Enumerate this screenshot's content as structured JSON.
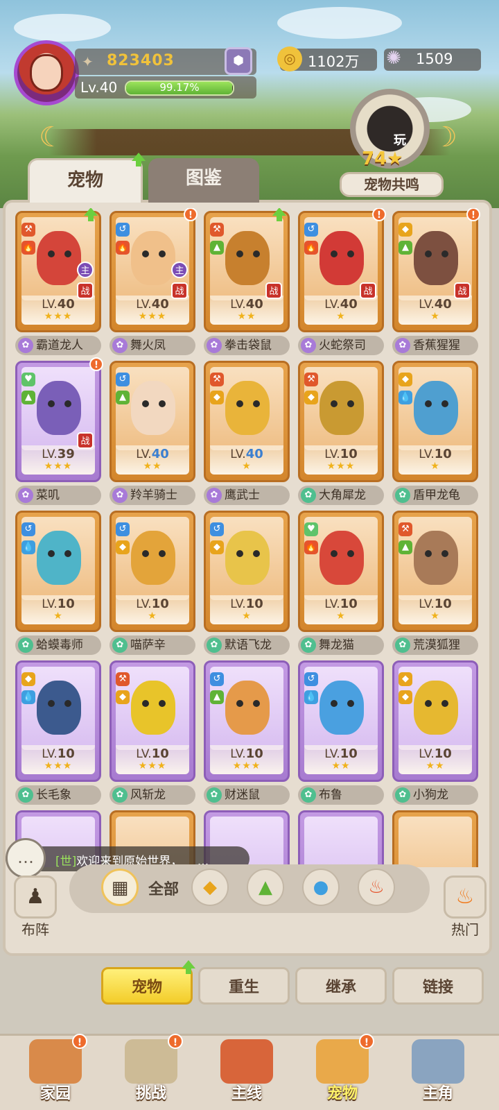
{
  "player": {
    "power": "823403",
    "level": "Lv.40",
    "exp_percent": "99.17%",
    "exp_fraction": 0.9917
  },
  "currency": {
    "gold": "1102万",
    "shells": "1509"
  },
  "resonance": {
    "play_label": "玩",
    "count": "74",
    "label": "宠物共鸣"
  },
  "tabs": [
    {
      "label": "宠物"
    },
    {
      "label": "图鉴"
    }
  ],
  "pets": [
    {
      "name": "霸道龙人",
      "lv": "40",
      "stars": "★★★",
      "card": "orange",
      "paw": "purple",
      "main": "主",
      "battle": "战",
      "elem1": "⚒",
      "elem2": "🔥",
      "c": "#d4453a"
    },
    {
      "name": "舞火凤",
      "lv": "40",
      "stars": "★★★",
      "card": "orange",
      "paw": "purple",
      "main": "主",
      "battle": "战",
      "elem1": "↺",
      "elem2": "🔥",
      "c": "#f0c08a"
    },
    {
      "name": "拳击袋鼠",
      "lv": "40",
      "stars": "★★",
      "card": "orange",
      "paw": "purple",
      "battle": "战",
      "elem1": "⚒",
      "elem2": "▲",
      "c": "#c7802e"
    },
    {
      "name": "火蛇祭司",
      "lv": "40",
      "stars": "★",
      "card": "orange",
      "paw": "purple",
      "battle": "战",
      "elem1": "↺",
      "elem2": "🔥",
      "c": "#d23a36"
    },
    {
      "name": "香蕉猩猩",
      "lv": "40",
      "stars": "★",
      "card": "orange",
      "paw": "purple",
      "battle": "战",
      "elem1": "◆",
      "elem2": "▲",
      "c": "#7d5040"
    },
    {
      "name": "菜叽",
      "lv": "39",
      "stars": "★★★",
      "card": "purple",
      "paw": "purple",
      "battle": "战",
      "elem1": "♥",
      "elem2": "▲",
      "c": "#7a5fb8"
    },
    {
      "name": "羚羊骑士",
      "lv": "40",
      "stars": "★★",
      "card": "orange",
      "paw": "purple",
      "blue": true,
      "elem1": "↺",
      "elem2": "▲",
      "c": "#f2d8c0"
    },
    {
      "name": "鹰武士",
      "lv": "40",
      "stars": "★",
      "card": "orange",
      "paw": "purple",
      "blue": true,
      "elem1": "⚒",
      "elem2": "◆",
      "c": "#e9b43a"
    },
    {
      "name": "大角犀龙",
      "lv": "10",
      "stars": "★★★",
      "card": "orange",
      "paw": "green",
      "elem1": "⚒",
      "elem2": "◆",
      "c": "#c99a32"
    },
    {
      "name": "盾甲龙龟",
      "lv": "10",
      "stars": "★",
      "card": "orange",
      "paw": "green",
      "elem1": "◆",
      "elem2": "💧",
      "c": "#4f9fd0"
    },
    {
      "name": "蛤蟆毒师",
      "lv": "10",
      "stars": "★",
      "card": "orange",
      "paw": "green",
      "elem1": "↺",
      "elem2": "💧",
      "c": "#4fb4c8"
    },
    {
      "name": "喵萨辛",
      "lv": "10",
      "stars": "★",
      "card": "orange",
      "paw": "green",
      "elem1": "↺",
      "elem2": "◆",
      "c": "#e3a43a"
    },
    {
      "name": "默语飞龙",
      "lv": "10",
      "stars": "★",
      "card": "orange",
      "paw": "green",
      "elem1": "↺",
      "elem2": "◆",
      "c": "#e8c44a"
    },
    {
      "name": "舞龙猫",
      "lv": "10",
      "stars": "★",
      "card": "orange",
      "paw": "green",
      "elem1": "♥",
      "elem2": "🔥",
      "c": "#d8483a"
    },
    {
      "name": "荒漠狐狸",
      "lv": "10",
      "stars": "★",
      "card": "orange",
      "paw": "green",
      "elem1": "⚒",
      "elem2": "▲",
      "c": "#a87a58"
    },
    {
      "name": "长毛象",
      "lv": "10",
      "stars": "★★★",
      "card": "purple",
      "paw": "green",
      "elem1": "◆",
      "elem2": "💧",
      "c": "#3c5a8e"
    },
    {
      "name": "风斩龙",
      "lv": "10",
      "stars": "★★★",
      "card": "purple",
      "paw": "green",
      "elem1": "⚒",
      "elem2": "◆",
      "c": "#e8c42a"
    },
    {
      "name": "财迷鼠",
      "lv": "10",
      "stars": "★★★",
      "card": "purple",
      "paw": "green",
      "elem1": "↺",
      "elem2": "▲",
      "c": "#e59a4a"
    },
    {
      "name": "布鲁",
      "lv": "10",
      "stars": "★★",
      "card": "purple",
      "paw": "green",
      "elem1": "↺",
      "elem2": "💧",
      "c": "#4aa0e0"
    },
    {
      "name": "小狗龙",
      "lv": "10",
      "stars": "★★",
      "card": "purple",
      "paw": "green",
      "elem1": "◆",
      "elem2": "◆",
      "c": "#e6b830"
    }
  ],
  "chat": {
    "channel": "[世]",
    "message": "欢迎来到原始世界，",
    "ellipsis": "..."
  },
  "filter": {
    "all": "全部",
    "left": "布阵",
    "right": "热门"
  },
  "actions": [
    "宠物",
    "重生",
    "继承",
    "链接"
  ],
  "nav": [
    {
      "label": "家园",
      "color": "#d98a4a"
    },
    {
      "label": "挑战",
      "color": "#cdbb96"
    },
    {
      "label": "主线",
      "color": "#d8653a"
    },
    {
      "label": "宠物",
      "color": "#e9a94a"
    },
    {
      "label": "主角",
      "color": "#8aa4c0"
    }
  ]
}
